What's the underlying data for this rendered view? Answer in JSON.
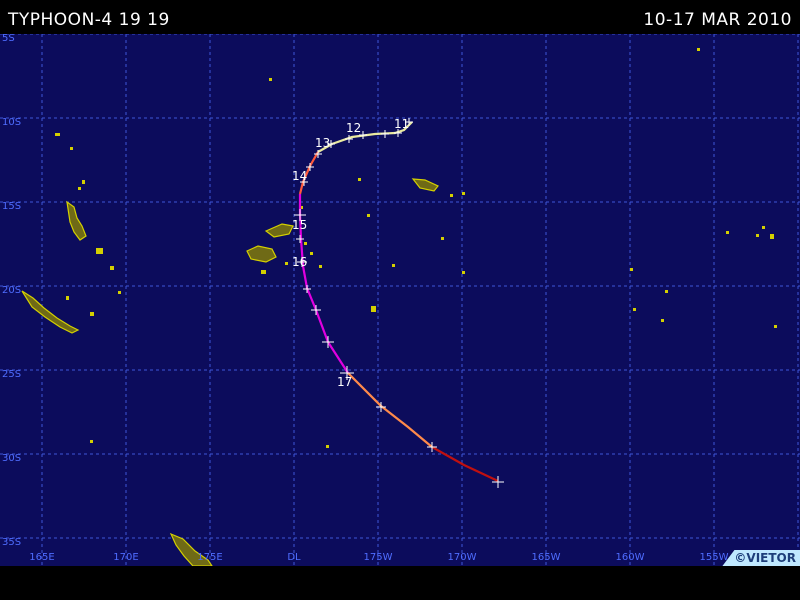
{
  "header": {
    "title": "TYPHOON-4 19 19",
    "date_range": "10-17 MAR 2010"
  },
  "map": {
    "ocean_color": "#0c0c5c",
    "grid_color": "#3e56d8",
    "land_outline_color": "#d4d000",
    "land_fill_color": "#6f6a16",
    "latitude_labels": [
      "5S",
      "10S",
      "15S",
      "20S",
      "25S",
      "30S",
      "35S"
    ],
    "longitude_labels": [
      "165E",
      "170E",
      "175E",
      "DL",
      "175W",
      "170W",
      "165W",
      "160W",
      "155W"
    ]
  },
  "track": {
    "colors_by_stage": [
      "#eaeaa0",
      "#ff5a3c",
      "#e000e0",
      "#ff8a4a",
      "#c01010"
    ],
    "day_labels": [
      "11",
      "12",
      "13",
      "14",
      "15",
      "16",
      "17"
    ]
  },
  "footer": {
    "copyright": "©VIETOR"
  }
}
